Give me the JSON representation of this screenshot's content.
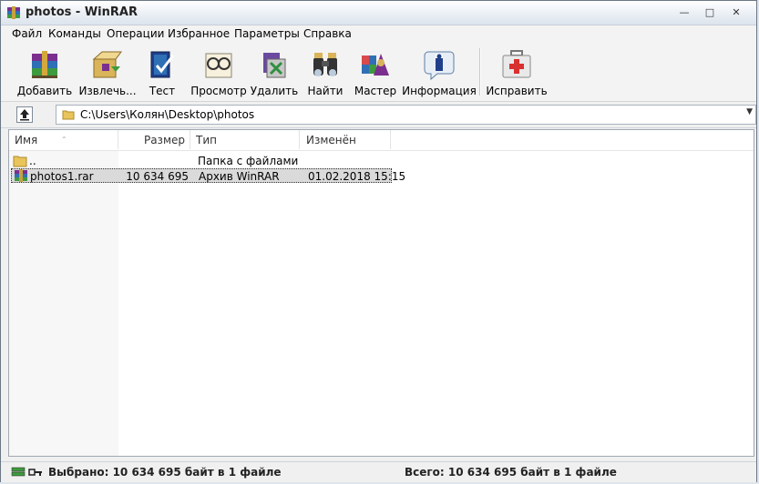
{
  "window": {
    "title": "photos - WinRAR"
  },
  "menu": [
    "Файл",
    "Команды",
    "Операции",
    "Избранное",
    "Параметры",
    "Справка"
  ],
  "toolbar": [
    {
      "label": "Добавить",
      "icon": "add-archive-icon"
    },
    {
      "label": "Извлечь...",
      "icon": "extract-icon"
    },
    {
      "label": "Тест",
      "icon": "test-icon"
    },
    {
      "label": "Просмотр",
      "icon": "view-icon"
    },
    {
      "label": "Удалить",
      "icon": "delete-icon"
    },
    {
      "label": "Найти",
      "icon": "find-icon"
    },
    {
      "label": "Мастер",
      "icon": "wizard-icon"
    },
    {
      "label": "Информация",
      "icon": "info-icon"
    },
    {
      "label": "Исправить",
      "icon": "repair-icon"
    }
  ],
  "path": {
    "value": "C:\\Users\\Колян\\Desktop\\photos"
  },
  "columns": [
    "Имя",
    "Размер",
    "Тип",
    "Изменён"
  ],
  "rows": [
    {
      "name": "..",
      "size": "",
      "type": "Папка с файлами",
      "modified": "",
      "icon": "folder-icon"
    },
    {
      "name": "photos1.rar",
      "size": "10 634 695",
      "type": "Архив WinRAR",
      "modified": "01.02.2018 15:15",
      "icon": "rar-archive-icon",
      "selected": true
    }
  ],
  "status": {
    "selected": "Выбрано: 10 634 695 байт в 1 файле",
    "total": "Всего: 10 634 695 байт в 1 файле"
  },
  "colors": {
    "accent": "#3a6ea5",
    "selection": "#dadada"
  }
}
